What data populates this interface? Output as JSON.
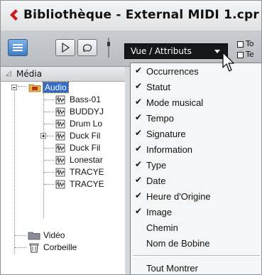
{
  "window": {
    "title": "Bibliothèque - External MIDI 1.cpr",
    "accent": "#cc1a1a"
  },
  "toolbar": {
    "view_select": {
      "value": "Vue / Attributs"
    },
    "side_options": [
      "To",
      "Te"
    ]
  },
  "tree_header": {
    "column_title": "Média"
  },
  "tree": {
    "audio_folder": "Audio",
    "audio_items": [
      "Bass-01",
      "BUDDYJ",
      "Drum Lo",
      "Duck Fil",
      "Duck Fil",
      "Lonestar",
      "TRACYE",
      "TRACYE"
    ],
    "video_folder": "Vidéo",
    "trash": "Corbeille"
  },
  "menu": {
    "items": [
      {
        "label": "Occurrences",
        "checked": "✔"
      },
      {
        "label": "Statut",
        "checked": "✔"
      },
      {
        "label": "Mode musical",
        "checked": "✔"
      },
      {
        "label": "Tempo",
        "checked": "✔"
      },
      {
        "label": "Signature",
        "checked": "✔"
      },
      {
        "label": "Information",
        "checked": "✔"
      },
      {
        "label": "Type",
        "checked": "✔"
      },
      {
        "label": "Date",
        "checked": "✔"
      },
      {
        "label": "Heure d'Origine",
        "checked": "✔"
      },
      {
        "label": "Image",
        "checked": "✔"
      },
      {
        "label": "Chemin",
        "checked": ""
      },
      {
        "label": "Nom de Bobine",
        "checked": ""
      }
    ],
    "show_all": "Tout Montrer"
  }
}
